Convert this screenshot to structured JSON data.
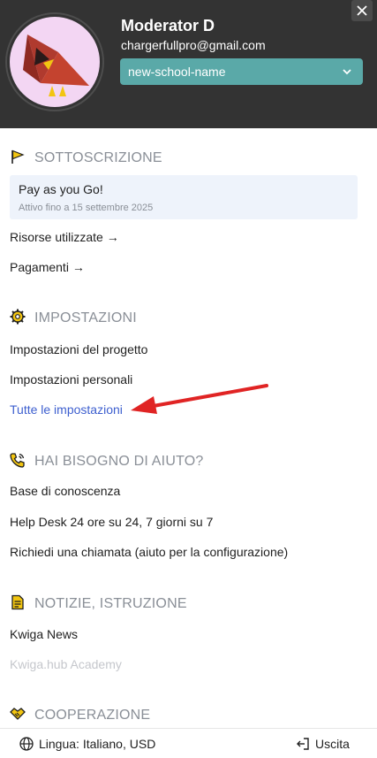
{
  "header": {
    "user_name": "Moderator D",
    "user_email": "chargerfullpro@gmail.com",
    "school_select_value": "new-school-name",
    "close_icon": "close-icon"
  },
  "subscription": {
    "title": "SOTTOSCRIZIONE",
    "icon": "flag-icon",
    "plan_name": "Pay as you Go!",
    "plan_expiry": "Attivo fino a 15 settembre 2025",
    "resources_link": "Risorse utilizzate →",
    "payments_link": "Pagamenti →"
  },
  "settings": {
    "title": "IMPOSTAZIONI",
    "icon": "gear-icon",
    "project_settings": "Impostazioni del progetto",
    "personal_settings": "Impostazioni personali",
    "all_settings": "Tutte le impostazioni"
  },
  "help": {
    "title": "HAI BISOGNO DI AIUTO?",
    "icon": "phone-icon",
    "knowledge_base": "Base di conoscenza",
    "help_desk": "Help Desk 24 ore su 24, 7 giorni su 7",
    "request_call": "Richiedi una chiamata (aiuto per la configurazione)"
  },
  "news": {
    "title": "NOTIZIE, ISTRUZIONE",
    "icon": "document-icon",
    "kwiga_news": "Kwiga News",
    "academy": "Kwiga.hub Academy"
  },
  "cooperation": {
    "title": "COOPERAZIONE",
    "icon": "handshake-icon"
  },
  "footer": {
    "language": "Lingua: Italiano, USD",
    "logout": "Uscita"
  },
  "colors": {
    "header_bg": "#333333",
    "select_bg": "#5aa9a8",
    "accent_blue": "#3d5fcf",
    "icon_yellow": "#f2c511",
    "annotation_red": "#e02424"
  }
}
